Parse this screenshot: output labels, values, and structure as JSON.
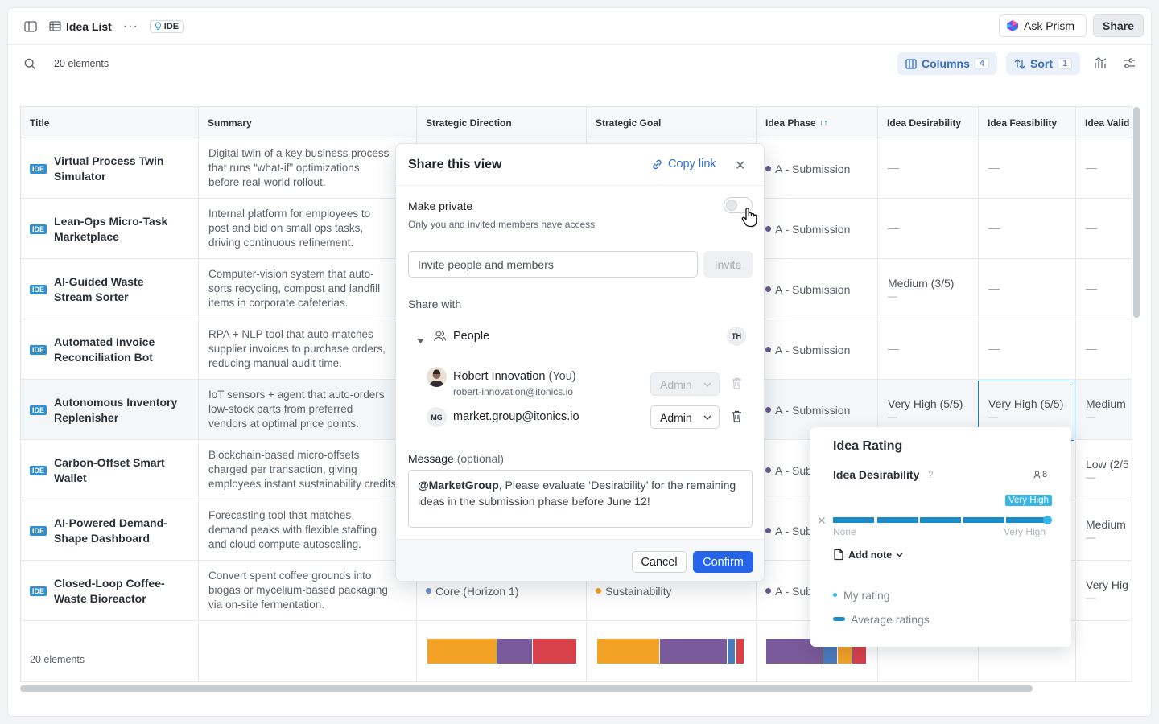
{
  "topbar": {
    "title": "Idea List",
    "ide_chip": "IDE",
    "ask_label": "Ask Prism",
    "share_label": "Share"
  },
  "subbar": {
    "count": "20 elements",
    "columns_label": "Columns",
    "columns_count": "4",
    "sort_label": "Sort",
    "sort_count": "1"
  },
  "table": {
    "headers": [
      "Title",
      "Summary",
      "Strategic Direction",
      "Strategic Goal",
      "Idea Phase",
      "Idea Desirability",
      "Idea Feasibility",
      "Idea Valid"
    ],
    "phase_sort_icon": "↓↑",
    "rows": [
      {
        "badge": "IDE",
        "title": "Virtual Process Twin Simulator",
        "summary": [
          "Digital twin of a key business process",
          "that runs “what-if” optimizations",
          "before real-world rollout."
        ],
        "phase": "A - Submission",
        "desirability": "—",
        "feasibility": "—",
        "validity": "—"
      },
      {
        "badge": "IDE",
        "title": "Lean-Ops Micro-Task Marketplace",
        "summary": [
          "Internal platform for employees to",
          "post and bid on small ops tasks,",
          "driving continuous refinement."
        ],
        "phase": "A - Submission",
        "desirability": "—",
        "feasibility": "—",
        "validity": "—"
      },
      {
        "badge": "IDE",
        "title": "AI-Guided Waste Stream Sorter",
        "summary": [
          "Computer-vision system that auto-",
          "sorts recycling, compost and landfill",
          "items in corporate cafeterias."
        ],
        "phase": "A - Submission",
        "desirability": "Medium (3/5)",
        "feasibility": "—",
        "validity": "—"
      },
      {
        "badge": "IDE",
        "title": "Automated Invoice Reconciliation Bot",
        "summary": [
          "RPA + NLP tool that auto-matches",
          "supplier invoices to purchase orders,",
          "reducing manual audit time."
        ],
        "phase": "A - Submission",
        "desirability": "—",
        "feasibility": "—",
        "validity": "—"
      },
      {
        "badge": "IDE",
        "title": "Autonomous Inventory Replenisher",
        "summary": [
          "IoT sensors + agent that auto-orders",
          "low-stock parts from preferred",
          "vendors at optimal price points."
        ],
        "phase": "A - Submission",
        "desirability": "Very High (5/5)",
        "feasibility": "Very High (5/5)",
        "validity": "Medium"
      },
      {
        "badge": "IDE",
        "title": "Carbon-Offset Smart Wallet",
        "summary": [
          "Blockchain-based micro-offsets",
          "charged per transaction, giving",
          "employees instant sustainability credits."
        ],
        "phase": "A - Sub",
        "desirability": "",
        "feasibility": "",
        "validity": "Low (2/5"
      },
      {
        "badge": "IDE",
        "title": "AI-Powered Demand-Shape Dashboard",
        "summary": [
          "Forecasting tool that matches",
          "demand peaks with flexible staffing",
          "and cloud compute autoscaling."
        ],
        "phase": "A - Sub",
        "desirability": "",
        "feasibility": "",
        "validity": "Medium"
      },
      {
        "badge": "IDE",
        "title": "Closed-Loop Coffee-Waste Bioreactor",
        "summary": [
          "Convert spent coffee grounds into",
          "biogas or mycelium-based packaging",
          "via on-site fermentation."
        ],
        "direction": "Core (Horizon 1)",
        "goal": "Sustainability",
        "phase": "A - Sub",
        "desirability": "",
        "feasibility": "",
        "validity": "Very Hig"
      }
    ],
    "footer_count": "20 elements",
    "colors": {
      "orange": "#f4a226",
      "purple": "#7a5a9a",
      "red": "#d8404a",
      "blue": "#4a7bbd",
      "phase_dot": "#6b5a8e",
      "core_dot": "#6b8fd6",
      "sust_dot": "#f4a226"
    }
  },
  "share": {
    "title": "Share this view",
    "copy_link": "Copy link",
    "make_private": "Make private",
    "private_hint": "Only you and invited members have access",
    "invite_placeholder": "Invite people and members",
    "invite_button": "Invite",
    "share_with": "Share with",
    "people": "People",
    "th_initials": "TH",
    "person1_name": "Robert Innovation",
    "person1_you": "(You)",
    "person1_mail": "robert-innovation@itonics.io",
    "person1_role": "Admin",
    "person2_initials": "MG",
    "person2_mail": "market.group@itonics.io",
    "person2_role": "Admin",
    "message_label": "Message",
    "message_optional": "(optional)",
    "message_mention": "@MarketGroup",
    "message_text": ", Please evaluate ‘Desirability’ for the remaining ideas in the submission phase before June 12!",
    "cancel": "Cancel",
    "confirm": "Confirm"
  },
  "rating_popover": {
    "title": "Idea Rating",
    "subtitle": "Idea Desirability",
    "help": "?",
    "voters": "8",
    "tag": "Very High",
    "level": 1.0,
    "min_label": "None",
    "max_label": "Very High",
    "add_note": "Add note",
    "legend_my": "My rating",
    "legend_avg": "Average ratings"
  }
}
